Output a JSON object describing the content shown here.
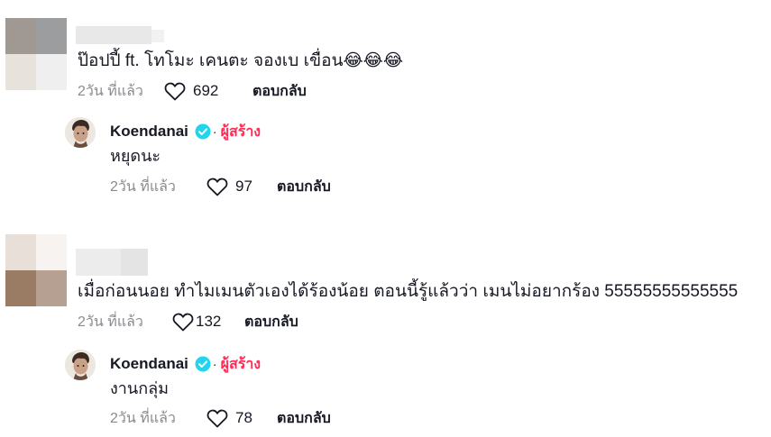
{
  "comments": [
    {
      "text": "ป๊อปปี้ ft. โทโมะ เคนตะ จองเบ เขื่อน😂😂😂",
      "date": "2วัน ที่แล้ว",
      "likes": "692",
      "reply_label": "ตอบกลับ",
      "avatar_colors": [
        "#a09893",
        "#9c9d9f",
        "#e8e2dd",
        "#efefef"
      ],
      "reply": {
        "author": "Koendanai",
        "badge": "ผู้สร้าง",
        "text": "หยุดนะ",
        "date": "2วัน ที่แล้ว",
        "likes": "97",
        "reply_label": "ตอบกลับ"
      }
    },
    {
      "text": "เมื่อก่อนนอย ทำไมเมนตัวเองได้ร้องน้อย ตอนนี้รู้แล้วว่า เมนไม่อยากร้อง 55555555555555",
      "date": "2วัน ที่แล้ว",
      "likes": "132",
      "reply_label": "ตอบกลับ",
      "avatar_colors": [
        "#e8dfd9",
        "#f7f3f1",
        "#9a7b63",
        "#b6a091"
      ],
      "reply": {
        "author": "Koendanai",
        "badge": "ผู้สร้าง",
        "text": "งานกลุ่ม",
        "date": "2วัน ที่แล้ว",
        "likes": "78",
        "reply_label": "ตอบกลับ"
      }
    }
  ],
  "icons": {
    "like": "heart-outline-icon",
    "verified": "verified-check-icon"
  },
  "colors": {
    "creator_badge": "#fe2c55",
    "verified": "#20d5ec",
    "meta_text": "#8a8b91"
  }
}
